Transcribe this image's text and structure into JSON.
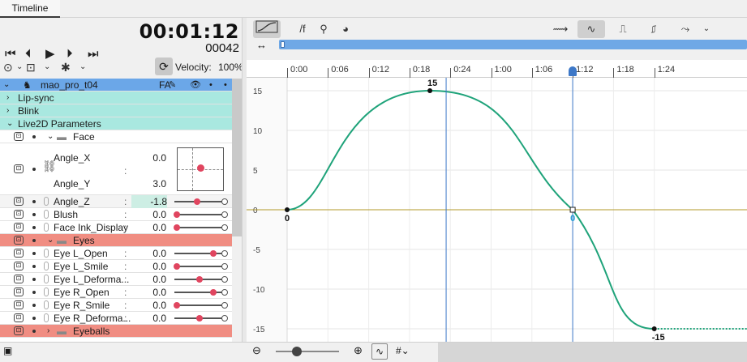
{
  "tabs": [
    {
      "label": "Timeline"
    }
  ],
  "transport": {
    "timecode": "00:01:12",
    "frames": "00042"
  },
  "left_toolbar": {
    "velocity_label": "Velocity:",
    "velocity_value": "100%"
  },
  "tree": [
    {
      "label": "mao_pro_t04",
      "kind": "model",
      "badge": "FA",
      "bg": "#6ba7e8"
    },
    {
      "label": "Lip-sync",
      "kind": "group",
      "bg": "#a9e8e0"
    },
    {
      "label": "Blink",
      "kind": "group",
      "bg": "#a9e8e0"
    },
    {
      "label": "Live2D Parameters",
      "kind": "group",
      "bg": "#a9e8e0"
    },
    {
      "label": "Face",
      "kind": "folder",
      "bg": "#ffffff"
    },
    {
      "label": "Angle_X",
      "value": "0.0",
      "kind": "param2d"
    },
    {
      "label": "Angle_Y",
      "value": "3.0",
      "kind": "param2d"
    },
    {
      "label": "Angle_Z",
      "value": "-1.8",
      "kind": "param",
      "selected": true,
      "slider": 0.45
    },
    {
      "label": "Blush",
      "value": "0.0",
      "kind": "param",
      "slider": 0.0
    },
    {
      "label": "Face Ink_Display",
      "value": "0.0",
      "kind": "param",
      "slider": 0.0
    },
    {
      "label": "Eyes",
      "kind": "folder",
      "bg": "#f08d82"
    },
    {
      "label": "Eye L_Open",
      "value": "0.0",
      "kind": "param",
      "slider": 0.8
    },
    {
      "label": "Eye L_Smile",
      "value": "0.0",
      "kind": "param",
      "slider": 0.0
    },
    {
      "label": "Eye L_Deforma...",
      "value": "0.0",
      "kind": "param",
      "slider": 0.5
    },
    {
      "label": "Eye R_Open",
      "value": "0.0",
      "kind": "param",
      "slider": 0.8
    },
    {
      "label": "Eye R_Smile",
      "value": "0.0",
      "kind": "param",
      "slider": 0.0
    },
    {
      "label": "Eye R_Deforma...",
      "value": "0.0",
      "kind": "param",
      "slider": 0.5
    },
    {
      "label": "Eyeballs",
      "kind": "folder",
      "bg": "#f08d82"
    }
  ],
  "graph_toolbar": {
    "fx_label": "/f"
  },
  "graph": {
    "time_ticks": [
      "0:00",
      "0:06",
      "0:12",
      "0:18",
      "0:24",
      "1:00",
      "1:06",
      "1:12",
      "1:18",
      "1:24"
    ],
    "y_ticks": [
      "15",
      "10",
      "5",
      "0",
      "-5",
      "-10",
      "-15"
    ],
    "keyframes": [
      {
        "time": "0:00",
        "value": 0,
        "label": "0"
      },
      {
        "time": "0:21",
        "value": 15,
        "label": "15"
      },
      {
        "time": "1:12",
        "value": 0,
        "label": "0",
        "selected": true
      },
      {
        "time": "1:24",
        "value": -15,
        "label": "-15"
      }
    ],
    "playhead": "1:12",
    "colors": {
      "curve": "#1fa37a",
      "zero_line": "#b39a2a",
      "playhead": "#3d78c8",
      "selected_label": "#2a9fd6"
    }
  }
}
